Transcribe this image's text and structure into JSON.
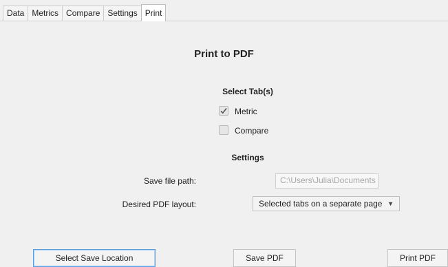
{
  "tabs": [
    "Data",
    "Metrics",
    "Compare",
    "Settings",
    "Print"
  ],
  "active_tab": "Print",
  "title": "Print to PDF",
  "select_tabs": {
    "heading": "Select Tab(s)",
    "options": [
      {
        "label": "Metric",
        "checked": true
      },
      {
        "label": "Compare",
        "checked": false
      }
    ]
  },
  "settings": {
    "heading": "Settings",
    "save_path_label": "Save file path:",
    "save_path_value": "C:\\Users\\Julia\\Documents",
    "layout_label": "Desired PDF layout:",
    "layout_value": "Selected tabs on a separate page"
  },
  "buttons": {
    "select_location": "Select Save Location",
    "save_pdf": "Save PDF",
    "print_pdf": "Print PDF"
  }
}
